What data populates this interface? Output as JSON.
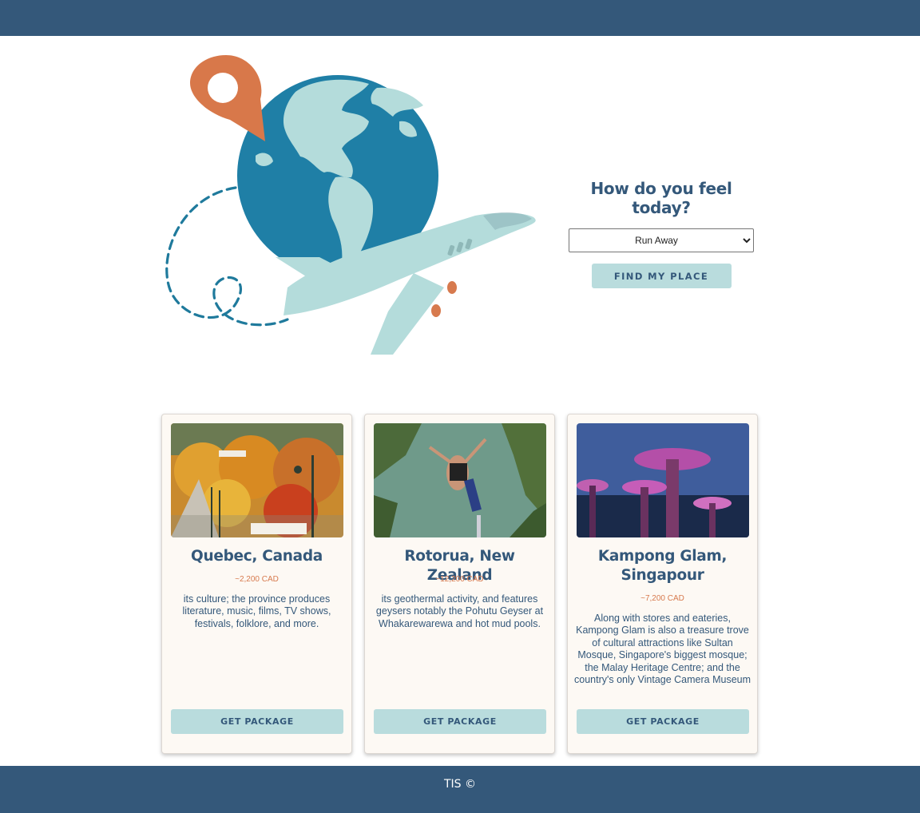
{
  "mood": {
    "heading": "How do you feel today?",
    "selected_option": "Run Away",
    "button_label": "FIND MY PLACE"
  },
  "cards": [
    {
      "title": "Quebec, Canada",
      "price": "~2,200 CAD",
      "description": "its culture; the province produces literature, music, films, TV shows, festivals, folklore, and more.",
      "button_label": "GET PACKAGE"
    },
    {
      "title": "Rotorua, New Zealand",
      "price": "~12,200 CAD",
      "description": "its geothermal activity, and features geysers notably the Pohutu Geyser at Whakarewarewa and hot mud pools.",
      "button_label": "GET PACKAGE"
    },
    {
      "title": "Kampong Glam, Singapour",
      "price": "~7,200 CAD",
      "description": "Along with stores and eateries, Kampong Glam is also a treasure trove of cultural attractions like Sultan Mosque, Singapore's biggest mosque; the Malay Heritage Centre; and the country's only Vintage Camera Museum",
      "button_label": "GET PACKAGE"
    }
  ],
  "footer": {
    "text": "TIS ©"
  },
  "colors": {
    "primary": "#34587a",
    "accent": "#b9dcdd",
    "price": "#d77a4e",
    "card_bg": "#fdf9f4"
  },
  "icons": [
    "map-pin-icon",
    "globe-icon",
    "airplane-icon"
  ]
}
